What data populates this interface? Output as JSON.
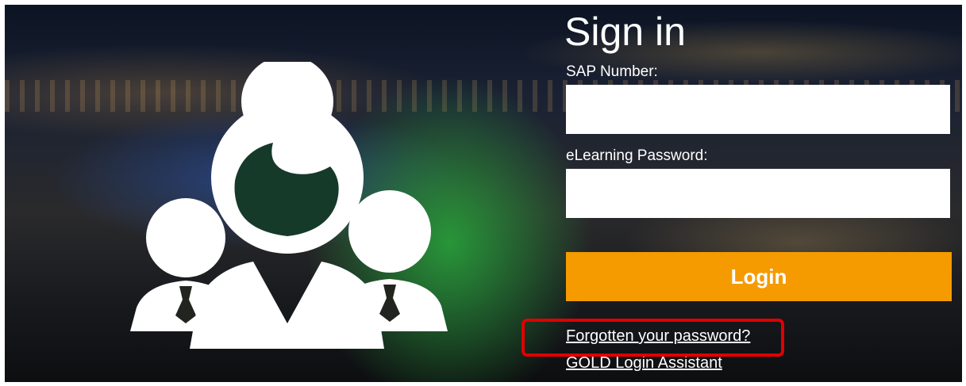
{
  "login": {
    "title": "Sign in",
    "sap_label": "SAP Number:",
    "sap_value": "",
    "password_label": "eLearning Password:",
    "password_value": "",
    "login_button": "Login",
    "forgot_link": "Forgotten your password?",
    "assistant_link": "GOLD Login Assistant"
  },
  "colors": {
    "accent": "#f59b00",
    "highlight": "#e00000",
    "text": "#ffffff"
  },
  "icons": {
    "hero": "people-group-icon"
  }
}
